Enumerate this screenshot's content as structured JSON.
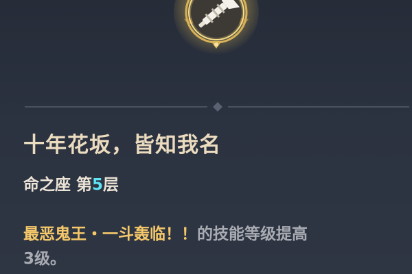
{
  "constellation": {
    "icon": "horn-bugle-icon",
    "title": "十年花坂，皆知我名",
    "level_prefix": "命之座 第",
    "level_number": "5",
    "level_suffix": "层",
    "desc_skill": "最恶鬼王・一斗轰临！！",
    "desc_text_line1": "的技能等级提高",
    "desc_text_line2": "3级。"
  },
  "colors": {
    "background": "#2a313f",
    "title": "#ecdcbf",
    "level_number": "#5ee3f4",
    "skill_highlight": "#f5c86a",
    "body_text": "#a9acb2",
    "icon_gold": "#e8c25a"
  }
}
